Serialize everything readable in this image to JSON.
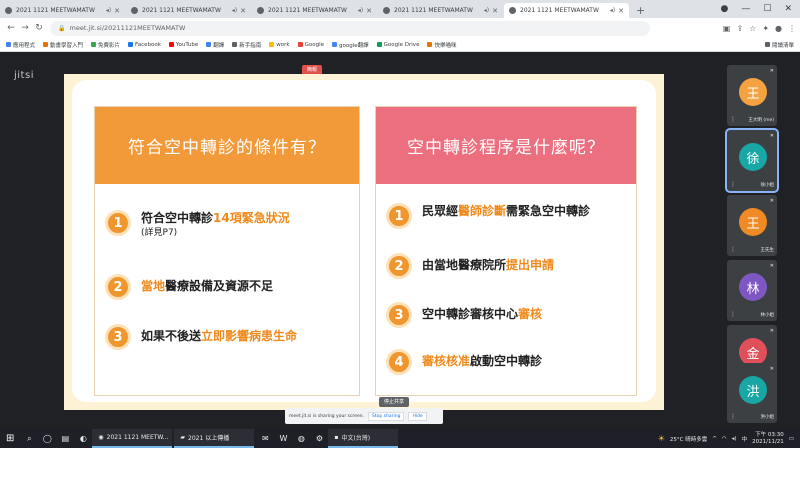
{
  "browser": {
    "tabs": [
      {
        "title": "2021 1121 MEETWAMATW",
        "active": false
      },
      {
        "title": "2021 1121 MEETWAMATW",
        "active": false
      },
      {
        "title": "2021 1121 MEETWAMATW",
        "active": false
      },
      {
        "title": "2021 1121 MEETWAMATW",
        "active": false
      },
      {
        "title": "2021 1121 MEETWAMATW",
        "active": true
      }
    ],
    "new_tab_symbol": "+",
    "url": "meet.jit.si/20211121MEETWAMATW",
    "bookmarks": [
      "應用程式",
      "動畫學習入門",
      "免費影片",
      "Facebook",
      "YouTube",
      "翻譯",
      "新手指南",
      "work",
      "Google",
      "google翻譯",
      "Google Drive",
      "快樂喵咪"
    ],
    "bookmarks_end": "閱讀清單"
  },
  "meet": {
    "logo_text": "jitsi",
    "presenting_tag": "簡報",
    "share_banner": {
      "text": "meet.jit.si is sharing your screen.",
      "stop_label": "Stop sharing",
      "hide_label": "Hide"
    },
    "stop_tooltip": "停止共享",
    "participants": [
      {
        "initial": "王",
        "name": "王大明 (me)",
        "color": "#f4a340",
        "active": false
      },
      {
        "initial": "徐",
        "name": "徐小姐",
        "color": "#19a7a5",
        "active": true
      },
      {
        "initial": "王",
        "name": "王先生",
        "color": "#f08a24",
        "active": false
      },
      {
        "initial": "林",
        "name": "林小姐",
        "color": "#7e57c2",
        "active": false
      },
      {
        "initial": "金",
        "name": "金先生",
        "color": "#e0505a",
        "active": false
      },
      {
        "initial": "洪",
        "name": "洪小姐",
        "color": "#19a7a5",
        "active": false
      }
    ]
  },
  "slide": {
    "left": {
      "heading": "符合空中轉診的條件有？",
      "items": [
        {
          "num": "1",
          "pre": "符合空中轉診",
          "hl": "14項緊急狀況",
          "post": "",
          "sub": "(詳見P7)"
        },
        {
          "num": "2",
          "pre": "",
          "hl": "當地",
          "post": "醫療設備及資源不足",
          "sub": ""
        },
        {
          "num": "3",
          "pre": "如果不後送",
          "hl": "立即影響病患生命",
          "post": "",
          "sub": ""
        }
      ]
    },
    "right": {
      "heading": "空中轉診程序是什麼呢？",
      "items": [
        {
          "num": "1",
          "pre": "民眾經",
          "hl": "醫師診斷",
          "post": "需緊急空中轉診",
          "sub": ""
        },
        {
          "num": "2",
          "pre": "由當地醫療院所",
          "hl": "提出申請",
          "post": "",
          "sub": ""
        },
        {
          "num": "3",
          "pre": "空中轉診審核中心",
          "hl": "審核",
          "post": "",
          "sub": ""
        },
        {
          "num": "4",
          "pre": "",
          "hl": "審核核准",
          "post": "啟動空中轉診",
          "sub": ""
        }
      ]
    }
  },
  "taskbar": {
    "apps": [
      "2021 1121 MEETW...",
      "2021 以上傳播"
    ],
    "app3": "中文(台灣)",
    "weather": "25°C 晴時多雲",
    "lang": "中",
    "time": "下午 03:30",
    "date": "2021/11/21"
  }
}
